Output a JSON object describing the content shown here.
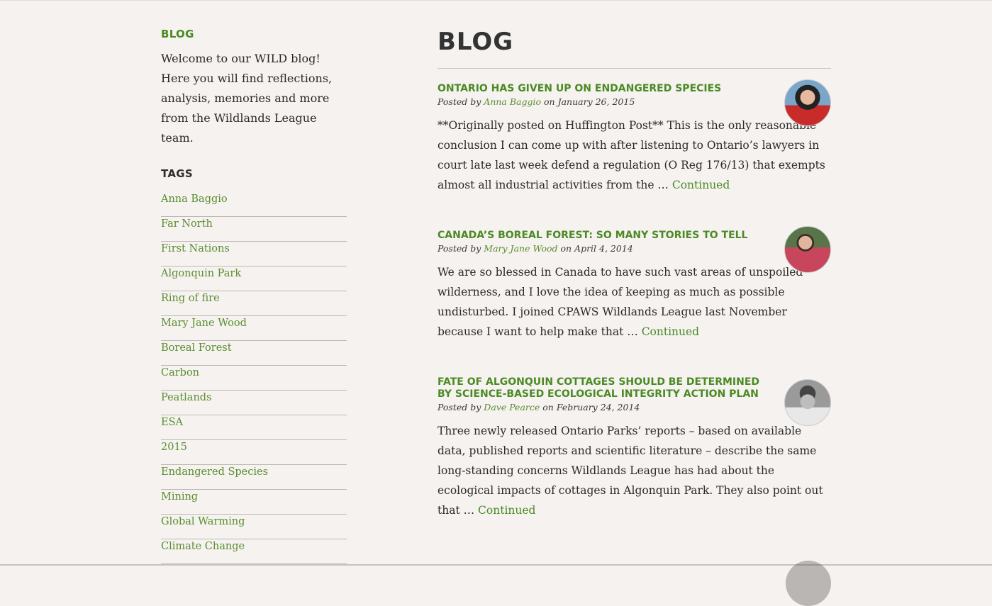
{
  "sidebar": {
    "blog_heading": "BLOG",
    "intro": "Welcome to our WILD blog! Here you will find reflections, analysis, memories and more from the Wildlands League team.",
    "tags_heading": "TAGS",
    "tags": [
      "Anna Baggio",
      "Far North",
      "First Nations",
      "Algonquin Park",
      "Ring of fire",
      "Mary Jane Wood",
      "Boreal Forest",
      "Carbon",
      "Peatlands",
      "ESA",
      "2015",
      "Endangered Species",
      "Mining",
      "Global Warming",
      "Climate Change"
    ]
  },
  "main": {
    "title": "BLOG",
    "posts": [
      {
        "title": "ONTARIO HAS GIVEN UP ON ENDANGERED SPECIES",
        "posted_by": "Posted by",
        "author": "Anna Baggio",
        "on": "on",
        "date": "January 26, 2015",
        "excerpt": "**Originally posted on Huffington Post** This is the only reasonable conclusion I can come up with after listening to Ontario’s lawyers in court late last week defend a regulation (O Reg 176/13) that exempts almost all industrial activities from the …",
        "continued": "Continued"
      },
      {
        "title": "CANADA’S BOREAL FOREST: SO MANY STORIES TO TELL",
        "posted_by": "Posted by",
        "author": "Mary Jane Wood",
        "on": "on",
        "date": "April 4, 2014",
        "excerpt": "We are so blessed in Canada to have such vast areas of unspoiled wilderness, and I love the idea of keeping as much as possible undisturbed. I joined CPAWS Wildlands League last November because I want to help make that …",
        "continued": "Continued"
      },
      {
        "title": "FATE OF ALGONQUIN COTTAGES SHOULD BE DETERMINED BY SCIENCE-BASED ECOLOGICAL INTEGRITY ACTION PLAN",
        "posted_by": "Posted by",
        "author": "Dave Pearce",
        "on": "on",
        "date": "February 24, 2014",
        "excerpt": "Three newly released Ontario Parks’ reports – based on available data, published reports and scientific literature – describe the same long-standing concerns Wildlands League has had about the ecological impacts of cottages in Algonquin Park. They also point out that …",
        "continued": "Continued"
      }
    ]
  }
}
